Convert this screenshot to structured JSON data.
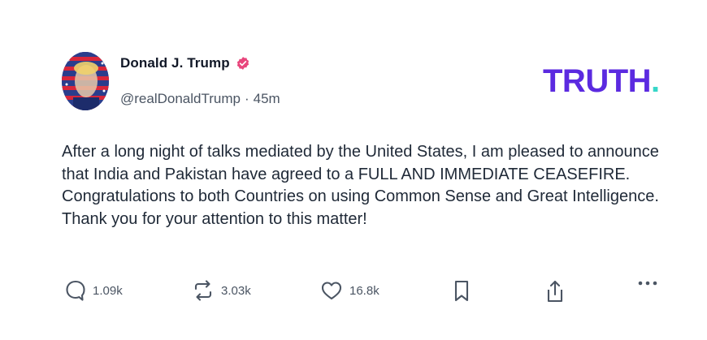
{
  "author": {
    "name": "Donald J. Trump",
    "handle": "@realDonaldTrump",
    "separator": "·",
    "time_ago": "45m",
    "verified_icon": "verified-badge-icon",
    "verified_color": "#e8467c"
  },
  "brand": {
    "logo_text": "TRUTH",
    "logo_dot": ".",
    "primary_color": "#5b2ae0",
    "accent_color": "#36d7c8"
  },
  "post": {
    "text": "After a long night of talks mediated by the United States, I am pleased to announce that India and Pakistan have agreed to a FULL AND IMMEDIATE CEASEFIRE. Congratulations to both Countries on using Common Sense and Great Intelligence. Thank you for your attention to this matter!"
  },
  "actions": {
    "replies": "1.09k",
    "retruths": "3.03k",
    "likes": "16.8k",
    "reply_icon": "reply-icon",
    "retruth_icon": "retruth-icon",
    "like_icon": "heart-icon",
    "bookmark_icon": "bookmark-icon",
    "share_icon": "share-icon",
    "more_icon": "more-icon"
  }
}
